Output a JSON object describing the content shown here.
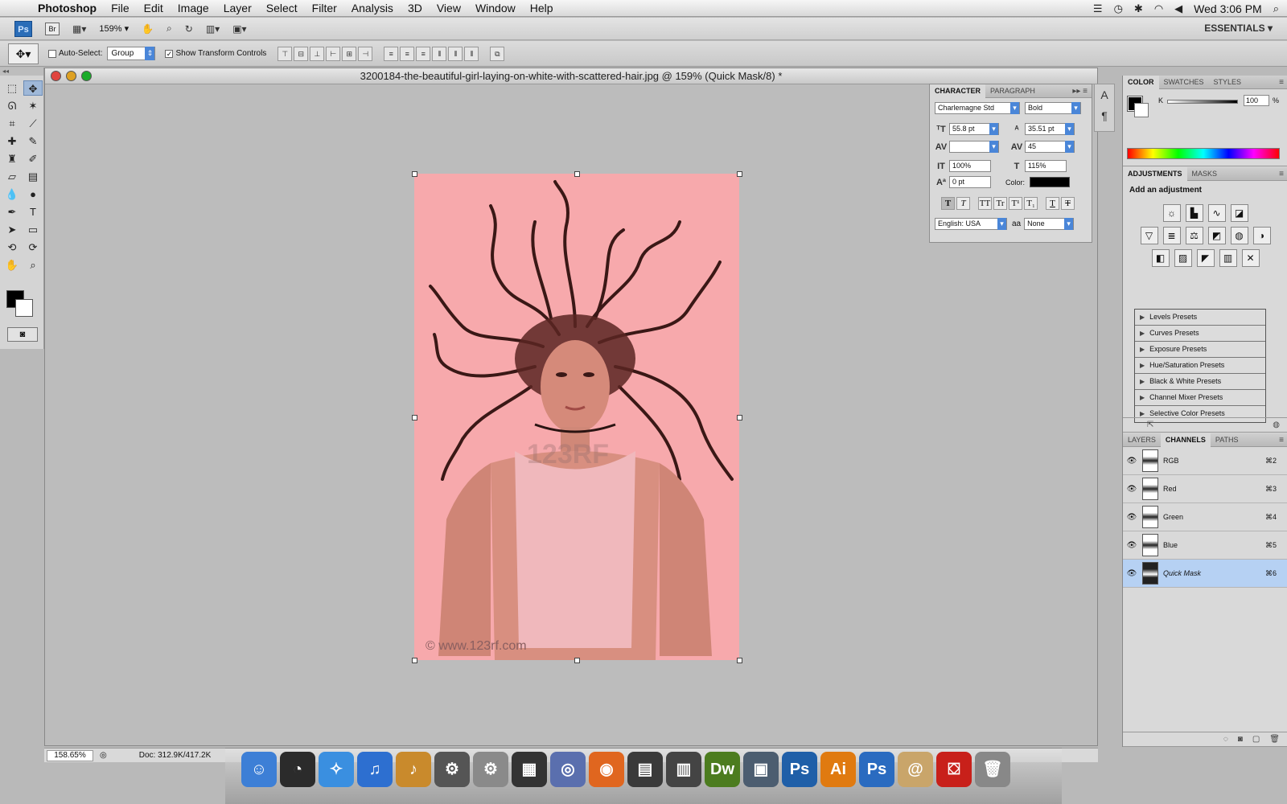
{
  "menubar": {
    "app_name": "Photoshop",
    "items": [
      "File",
      "Edit",
      "Image",
      "Layer",
      "Select",
      "Filter",
      "Analysis",
      "3D",
      "View",
      "Window",
      "Help"
    ],
    "clock": "Wed 3:06 PM",
    "status_icons": [
      "spaces-icon",
      "time-machine-icon",
      "bluetooth-icon",
      "wifi-icon",
      "volume-icon",
      "spotlight-icon"
    ]
  },
  "appbar": {
    "ps_label": "Ps",
    "br_label": "Br",
    "zoom": "159%",
    "workspace": "ESSENTIALS"
  },
  "options": {
    "auto_select_label": "Auto-Select:",
    "auto_select_value": "Group",
    "show_transform_label": "Show Transform Controls"
  },
  "document": {
    "title": "3200184-the-beautiful-girl-laying-on-white-with-scattered-hair.jpg @ 159% (Quick Mask/8) *",
    "watermark_mid": "123RF",
    "watermark": "© www.123rf.com"
  },
  "status": {
    "zoom": "158.65%",
    "doc_size": "Doc: 312.9K/417.2K"
  },
  "character": {
    "tabs": [
      "CHARACTER",
      "PARAGRAPH"
    ],
    "font_family": "Charlemagne Std",
    "font_style": "Bold",
    "font_size": "55.8 pt",
    "leading": "35.51 pt",
    "kerning": "",
    "tracking": "45",
    "vertical_scale": "100%",
    "horizontal_scale": "115%",
    "baseline_shift": "0 pt",
    "color_label": "Color:",
    "language": "English: USA",
    "antialias": "None",
    "aa_label": "aa",
    "style_buttons": [
      "T",
      "T",
      "TT",
      "Tr",
      "T¹",
      "T₁",
      "T",
      "T"
    ]
  },
  "color_panel": {
    "tabs": [
      "COLOR",
      "SWATCHES",
      "STYLES"
    ],
    "k_label": "K",
    "k_value": "100",
    "k_pct": "%"
  },
  "adjustments": {
    "tabs": [
      "ADJUSTMENTS",
      "MASKS"
    ],
    "heading": "Add an adjustment",
    "presets": [
      "Levels Presets",
      "Curves Presets",
      "Exposure Presets",
      "Hue/Saturation Presets",
      "Black & White Presets",
      "Channel Mixer Presets",
      "Selective Color Presets"
    ]
  },
  "channels": {
    "tabs": [
      "LAYERS",
      "CHANNELS",
      "PATHS"
    ],
    "rows": [
      {
        "name": "RGB",
        "key": "⌘2"
      },
      {
        "name": "Red",
        "key": "⌘3"
      },
      {
        "name": "Green",
        "key": "⌘4"
      },
      {
        "name": "Blue",
        "key": "⌘5"
      },
      {
        "name": "Quick Mask",
        "key": "⌘6"
      }
    ]
  },
  "dock": {
    "apps": [
      {
        "name": "finder-icon",
        "label": "☺",
        "color": "#3d7fd6"
      },
      {
        "name": "dashboard-icon",
        "label": "◔",
        "color": "#2b2b2b"
      },
      {
        "name": "safari-icon",
        "label": "✧",
        "color": "#3a8fe0"
      },
      {
        "name": "itunes-icon",
        "label": "♫",
        "color": "#2d6fd0"
      },
      {
        "name": "garageband-icon",
        "label": "♪",
        "color": "#c98a2c"
      },
      {
        "name": "utility-icon",
        "label": "⚙",
        "color": "#555555"
      },
      {
        "name": "system-preferences-icon",
        "label": "⚙",
        "color": "#8a8a8a"
      },
      {
        "name": "film-icon",
        "label": "▦",
        "color": "#333333"
      },
      {
        "name": "aperture-icon",
        "label": "◎",
        "color": "#5a6fae"
      },
      {
        "name": "firefox-icon",
        "label": "◉",
        "color": "#e0661f"
      },
      {
        "name": "final-cut-icon",
        "label": "▤",
        "color": "#3a3a3a"
      },
      {
        "name": "clapper-icon",
        "label": "▥",
        "color": "#444444"
      },
      {
        "name": "dreamweaver-icon",
        "label": "Dw",
        "color": "#4c7c1f"
      },
      {
        "name": "preview-icon",
        "label": "▣",
        "color": "#4c5d70"
      },
      {
        "name": "photoshop-icon",
        "label": "Ps",
        "color": "#1f5fa8"
      },
      {
        "name": "illustrator-icon",
        "label": "Ai",
        "color": "#e07a10"
      },
      {
        "name": "photoshop-alt-icon",
        "label": "Ps",
        "color": "#2a6bc0"
      },
      {
        "name": "address-book-icon",
        "label": "@",
        "color": "#c9a56a"
      },
      {
        "name": "acrobat-icon",
        "label": "⛋",
        "color": "#c8201a"
      },
      {
        "name": "trash-icon",
        "label": "🗑",
        "color": "#888888"
      }
    ]
  }
}
